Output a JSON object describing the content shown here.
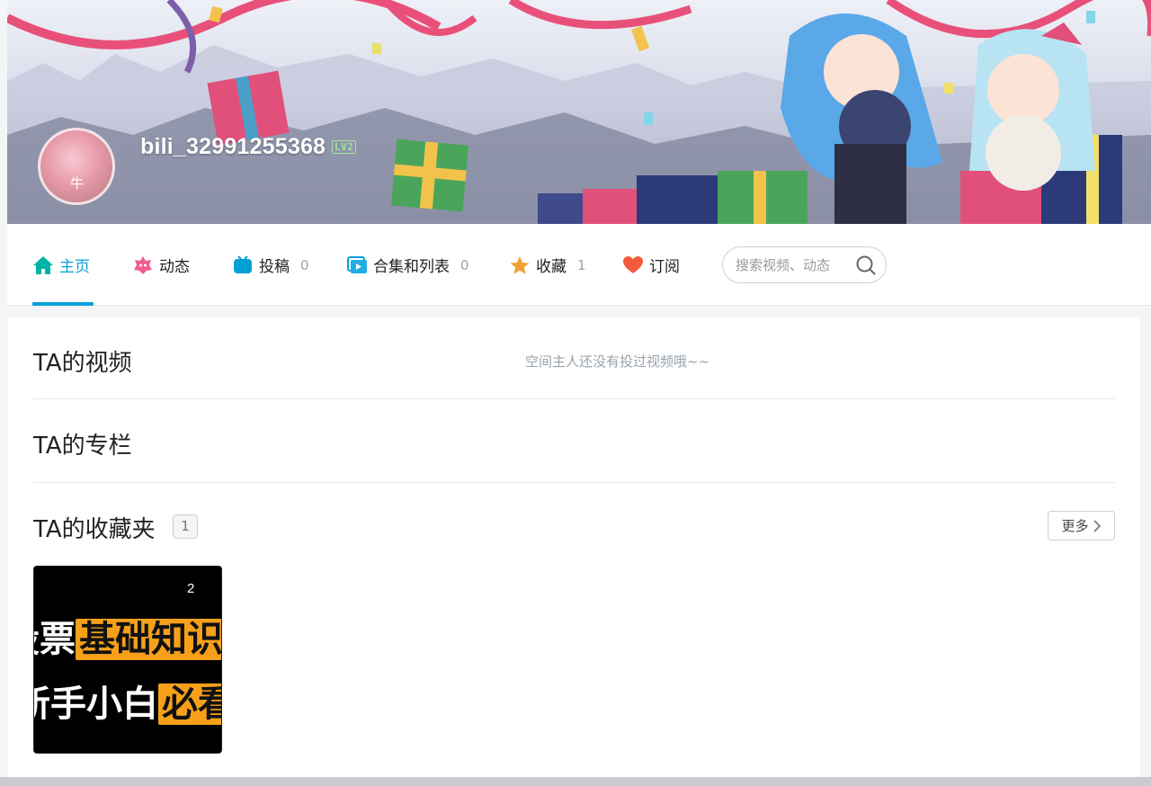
{
  "profile": {
    "username": "bili_32991255368",
    "level": "LV2",
    "avatar_label": "牛"
  },
  "nav": {
    "items": [
      {
        "label": "主页",
        "count": "",
        "icon": "home-icon"
      },
      {
        "label": "动态",
        "count": "",
        "icon": "dynamic-icon"
      },
      {
        "label": "投稿",
        "count": "0",
        "icon": "tv-icon"
      },
      {
        "label": "合集和列表",
        "count": "0",
        "icon": "playlist-icon"
      },
      {
        "label": "收藏",
        "count": "1",
        "icon": "star-icon"
      },
      {
        "label": "订阅",
        "count": "",
        "icon": "heart-icon"
      }
    ],
    "active_index": 0,
    "search_placeholder": "搜索视频、动态"
  },
  "sections": {
    "videos": {
      "title": "TA的视频",
      "empty_text": "空间主人还没有投过视频哦~~"
    },
    "articles": {
      "title": "TA的专栏"
    },
    "favorites": {
      "title": "TA的收藏夹",
      "count": "1",
      "more_label": "更多",
      "folders": [
        {
          "item_count": "2",
          "thumb_line1_plain": "股票",
          "thumb_line1_highlight": "基础知识",
          "thumb_line2_plain": "新手小白",
          "thumb_line2_highlight": "必看"
        }
      ]
    }
  },
  "colors": {
    "accent": "#00a1d6",
    "muted": "#99a2aa",
    "thumb_highlight": "#f6a01a"
  }
}
